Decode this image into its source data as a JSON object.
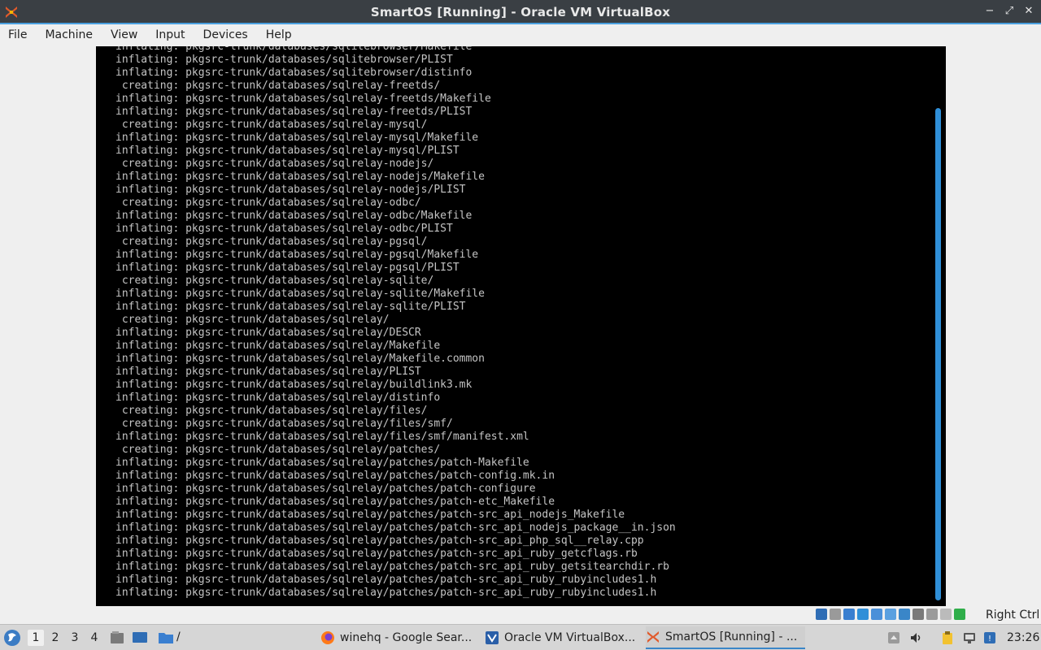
{
  "window": {
    "title": "SmartOS [Running] - Oracle VM VirtualBox",
    "controls": {
      "minimize": "−",
      "maximize": "⤢",
      "close": "✕"
    }
  },
  "menubar": {
    "items": [
      "File",
      "Machine",
      "View",
      "Input",
      "Devices",
      "Help"
    ]
  },
  "console": {
    "lines": [
      "inflating: pkgsrc-trunk/databases/sqlitebrowser/Makefile",
      "inflating: pkgsrc-trunk/databases/sqlitebrowser/PLIST",
      "inflating: pkgsrc-trunk/databases/sqlitebrowser/distinfo",
      " creating: pkgsrc-trunk/databases/sqlrelay-freetds/",
      "inflating: pkgsrc-trunk/databases/sqlrelay-freetds/Makefile",
      "inflating: pkgsrc-trunk/databases/sqlrelay-freetds/PLIST",
      " creating: pkgsrc-trunk/databases/sqlrelay-mysql/",
      "inflating: pkgsrc-trunk/databases/sqlrelay-mysql/Makefile",
      "inflating: pkgsrc-trunk/databases/sqlrelay-mysql/PLIST",
      " creating: pkgsrc-trunk/databases/sqlrelay-nodejs/",
      "inflating: pkgsrc-trunk/databases/sqlrelay-nodejs/Makefile",
      "inflating: pkgsrc-trunk/databases/sqlrelay-nodejs/PLIST",
      " creating: pkgsrc-trunk/databases/sqlrelay-odbc/",
      "inflating: pkgsrc-trunk/databases/sqlrelay-odbc/Makefile",
      "inflating: pkgsrc-trunk/databases/sqlrelay-odbc/PLIST",
      " creating: pkgsrc-trunk/databases/sqlrelay-pgsql/",
      "inflating: pkgsrc-trunk/databases/sqlrelay-pgsql/Makefile",
      "inflating: pkgsrc-trunk/databases/sqlrelay-pgsql/PLIST",
      " creating: pkgsrc-trunk/databases/sqlrelay-sqlite/",
      "inflating: pkgsrc-trunk/databases/sqlrelay-sqlite/Makefile",
      "inflating: pkgsrc-trunk/databases/sqlrelay-sqlite/PLIST",
      " creating: pkgsrc-trunk/databases/sqlrelay/",
      "inflating: pkgsrc-trunk/databases/sqlrelay/DESCR",
      "inflating: pkgsrc-trunk/databases/sqlrelay/Makefile",
      "inflating: pkgsrc-trunk/databases/sqlrelay/Makefile.common",
      "inflating: pkgsrc-trunk/databases/sqlrelay/PLIST",
      "inflating: pkgsrc-trunk/databases/sqlrelay/buildlink3.mk",
      "inflating: pkgsrc-trunk/databases/sqlrelay/distinfo",
      " creating: pkgsrc-trunk/databases/sqlrelay/files/",
      " creating: pkgsrc-trunk/databases/sqlrelay/files/smf/",
      "inflating: pkgsrc-trunk/databases/sqlrelay/files/smf/manifest.xml",
      " creating: pkgsrc-trunk/databases/sqlrelay/patches/",
      "inflating: pkgsrc-trunk/databases/sqlrelay/patches/patch-Makefile",
      "inflating: pkgsrc-trunk/databases/sqlrelay/patches/patch-config.mk.in",
      "inflating: pkgsrc-trunk/databases/sqlrelay/patches/patch-configure",
      "inflating: pkgsrc-trunk/databases/sqlrelay/patches/patch-etc_Makefile",
      "inflating: pkgsrc-trunk/databases/sqlrelay/patches/patch-src_api_nodejs_Makefile",
      "inflating: pkgsrc-trunk/databases/sqlrelay/patches/patch-src_api_nodejs_package__in.json",
      "inflating: pkgsrc-trunk/databases/sqlrelay/patches/patch-src_api_php_sql__relay.cpp",
      "inflating: pkgsrc-trunk/databases/sqlrelay/patches/patch-src_api_ruby_getcflags.rb",
      "inflating: pkgsrc-trunk/databases/sqlrelay/patches/patch-src_api_ruby_getsitearchdir.rb",
      "inflating: pkgsrc-trunk/databases/sqlrelay/patches/patch-src_api_ruby_rubyincludes1.h",
      "inflating: pkgsrc-trunk/databases/sqlrelay/patches/patch-src_api_ruby_rubyincludes1.h"
    ]
  },
  "statusbar": {
    "host_key": "Right Ctrl",
    "icons": [
      "hard-disk-icon",
      "optical-drive-icon",
      "audio-icon",
      "network-icon",
      "usb-icon",
      "shared-folder-icon",
      "display-icon",
      "recording-icon",
      "cpu-icon",
      "mouse-integration-icon",
      "keyboard-capture-icon"
    ]
  },
  "taskbar": {
    "workspaces": [
      "1",
      "2",
      "3",
      "4"
    ],
    "active_workspace": "1",
    "path_label": "/",
    "tasks": [
      {
        "label": "winehq - Google Sear...",
        "icon": "firefox-icon"
      },
      {
        "label": "Oracle VM VirtualBox...",
        "icon": "virtualbox-manager-icon"
      },
      {
        "label": "SmartOS [Running] - ...",
        "icon": "virtualbox-vm-icon"
      }
    ],
    "clock": "23:26"
  },
  "colors": {
    "titlebar": "#3a3f44",
    "accent": "#2f8fd8",
    "console_bg": "#000000",
    "console_fg": "#c4c4c4"
  }
}
